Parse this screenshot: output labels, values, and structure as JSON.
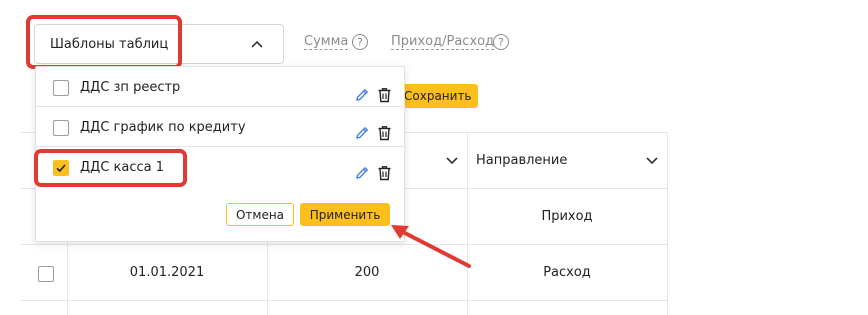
{
  "toolbar": {
    "templates_label": "Шаблоны таблиц",
    "sum_filter": "Сумма",
    "income_expense_filter": "Приход/Расход",
    "save_label": "Сохранить"
  },
  "dropdown": {
    "items": [
      {
        "label": "ДДС зп реестр",
        "checked": false
      },
      {
        "label": "ДДС график по кредиту",
        "checked": false
      },
      {
        "label": "ДДС касса 1",
        "checked": true
      }
    ],
    "cancel_label": "Отмена",
    "apply_label": "Применить"
  },
  "table": {
    "direction_header": "Направление",
    "rows": [
      {
        "date": "",
        "amount": "",
        "direction": "Приход"
      },
      {
        "date": "01.01.2021",
        "amount": "200",
        "direction": "Расход"
      }
    ]
  },
  "colors": {
    "accent": "#fcbf1e",
    "callout": "#e03a32",
    "edit_icon": "#3a7be0"
  }
}
